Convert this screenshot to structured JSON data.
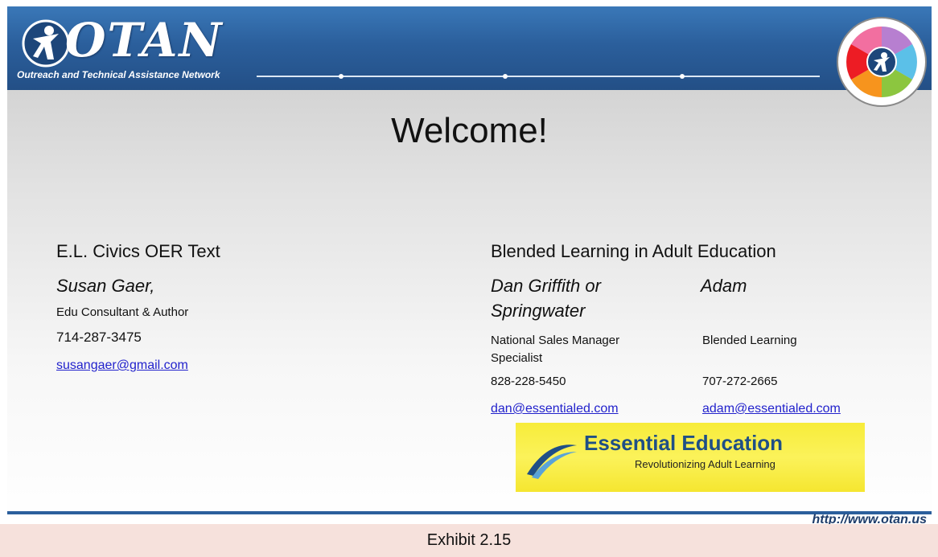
{
  "header": {
    "logo_text": "OTAN",
    "logo_subtitle": "Outreach and Technical Assistance Network"
  },
  "title": "Welcome!",
  "left_column": {
    "heading": "E.L. Civics OER Text",
    "name": "Susan Gaer,",
    "role": "Edu Consultant & Author",
    "phone": "714-287-3475",
    "email": "susangaer@gmail.com"
  },
  "right_column": {
    "heading": "Blended Learning in Adult Education",
    "name_left_line1": "Dan Griffith or",
    "name_left_line2": "Springwater",
    "name_right": "Adam",
    "role_left_line1": "National Sales Manager",
    "role_left_line2": "Specialist",
    "role_right": "Blended Learning",
    "phone_left": "828-228-5450",
    "phone_right": "707-272-2665",
    "email_left": "dan@essentialed.com",
    "email_right": "adam@essentialed.com"
  },
  "sponsor": {
    "name": "Essential Education",
    "tagline": "Revolutionizing Adult Learning"
  },
  "footer": {
    "url": "http://www.otan.us"
  },
  "caption": "Exhibit 2.15",
  "colors": {
    "banner": "#2b5f9c",
    "sponsor_yellow": "#f7ec3a",
    "link": "#2222cc",
    "caption_bg": "#f6e1dc"
  }
}
